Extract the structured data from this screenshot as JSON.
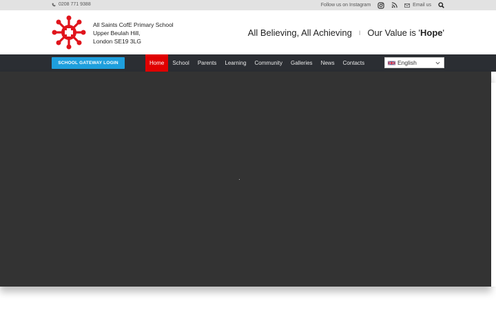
{
  "topbar": {
    "phone": "0208 771 9388",
    "instagram_label": "Follow us on Instagram",
    "email_label": "Email us",
    "icons": [
      "phone-icon",
      "instagram-icon",
      "rss-icon",
      "envelope-icon",
      "search-icon"
    ]
  },
  "header": {
    "address_line1": "All Saints CofE Primary School",
    "address_line2": "Upper Beulah Hill,",
    "address_line3": "London SE19 3LG",
    "motto_part1": "All Believing, All Achieving",
    "motto_sep": "I",
    "motto_part2_prefix": "Our Value is '",
    "motto_value": "Hope",
    "motto_part2_suffix": "'"
  },
  "nav": {
    "gateway_label": "SCHOOL GATEWAY LOGIN",
    "items": [
      {
        "label": "Home",
        "active": true
      },
      {
        "label": "School"
      },
      {
        "label": "Parents"
      },
      {
        "label": "Learning"
      },
      {
        "label": "Community"
      },
      {
        "label": "Galleries"
      },
      {
        "label": "News"
      },
      {
        "label": "Contacts"
      }
    ],
    "language": "English"
  },
  "colors": {
    "accent_red": "#e00000",
    "gateway_blue": "#1e9fdd",
    "nav_bg": "#2b2e33",
    "hero_bg": "#333333"
  }
}
